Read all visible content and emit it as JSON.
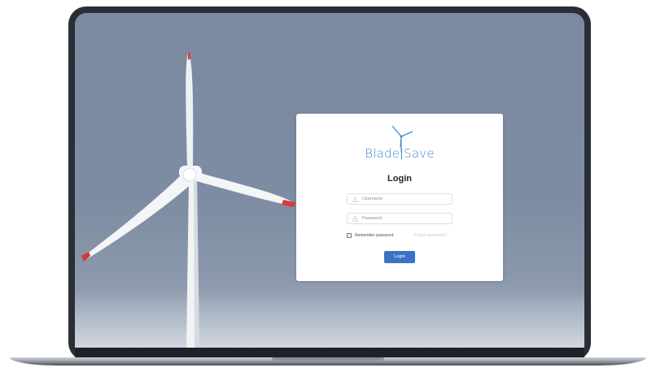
{
  "brand": {
    "name_left": "Blade",
    "name_right": "Save"
  },
  "login": {
    "title": "Login",
    "username_placeholder": "Username",
    "password_placeholder": "Password",
    "remember_label": "Remember password",
    "forgot_label": "Forgot password?",
    "submit_label": "Login"
  },
  "colors": {
    "accent": "#3b72c4",
    "brand": "#4a86c8",
    "blade_tip": "#d9383a"
  },
  "icons": {
    "user": "user-icon",
    "lock": "lock-icon",
    "logo": "wind-turbine-icon"
  }
}
